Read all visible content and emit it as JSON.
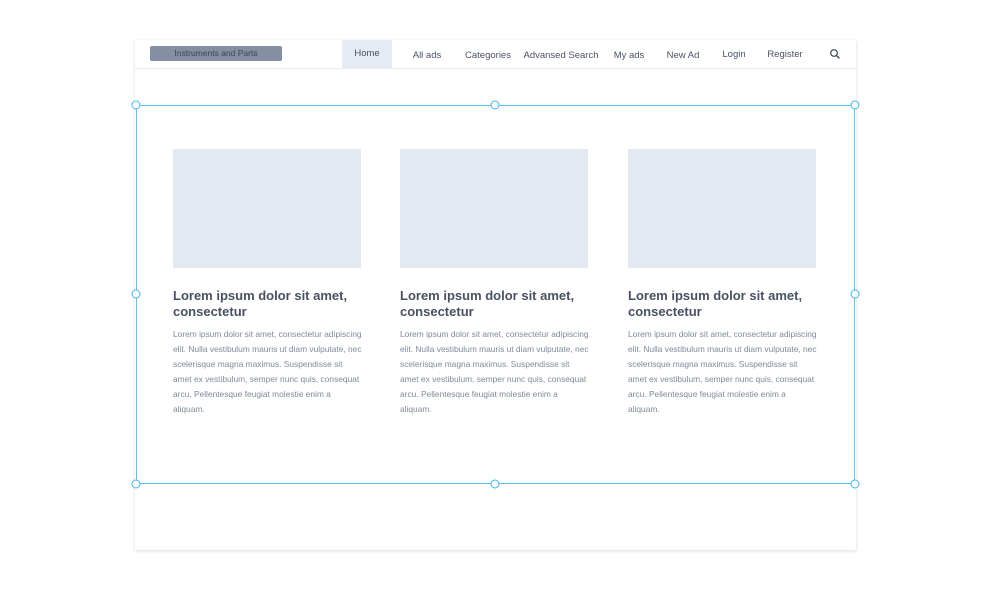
{
  "header": {
    "logo_text": "Instruments and Parts",
    "nav": [
      {
        "label": "Home",
        "active": true
      },
      {
        "label": "All ads"
      },
      {
        "label": "Categories"
      },
      {
        "label": "Advansed Search"
      },
      {
        "label": "My ads"
      },
      {
        "label": "New Ad"
      },
      {
        "label": "Login"
      },
      {
        "label": "Register"
      }
    ],
    "search_icon": "search-icon"
  },
  "cards": [
    {
      "title": "Lorem ipsum dolor sit amet, consectetur",
      "text": "Lorem ipsum dolor sit amet, consectetur adipiscing elit. Nulla vestibulum mauris ut diam vulputate, nec scelerisque magna maximus. Suspendisse sit amet ex vestibulum, semper nunc quis, consequat arcu. Pellentesque feugiat molestie enim a aliquam."
    },
    {
      "title": "Lorem ipsum dolor sit amet, consectetur",
      "text": "Lorem ipsum dolor sit amet, consectetur adipiscing elit. Nulla vestibulum mauris ut diam vulputate, nec scelerisque magna maximus. Suspendisse sit amet ex vestibulum, semper nunc quis, consequat arcu. Pellentesque feugiat molestie enim a aliquam."
    },
    {
      "title": "Lorem ipsum dolor sit amet, consectetur",
      "text": "Lorem ipsum dolor sit amet, consectetur adipiscing elit. Nulla vestibulum mauris ut diam vulputate, nec scelerisque magna maximus. Suspendisse sit amet ex vestibulum, semper nunc quis, consequat arcu. Pellentesque feugiat molestie enim a aliquam."
    }
  ],
  "colors": {
    "accent_selection": "#5cc4f2",
    "logo_bg": "#858fa3",
    "placeholder_bg": "#e4e9f1",
    "active_nav_bg": "#e6eaf2"
  }
}
